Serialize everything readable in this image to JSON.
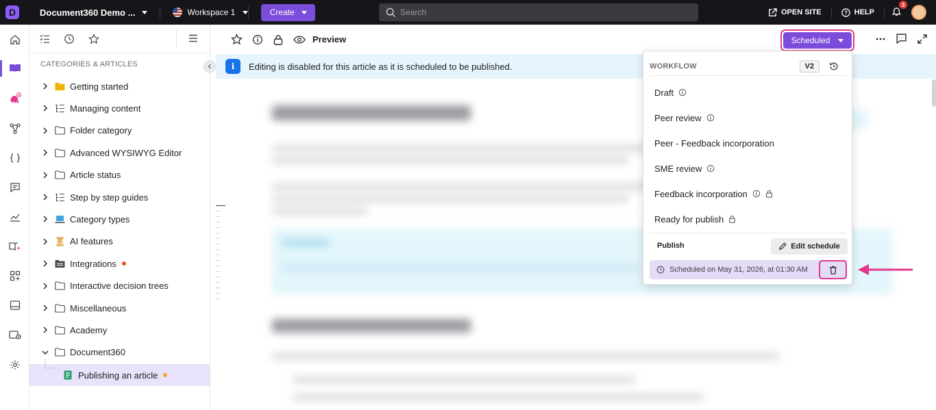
{
  "topbar": {
    "project_name": "Document360 Demo ...",
    "workspace": "Workspace 1",
    "create_label": "Create",
    "search_placeholder": "Search",
    "open_site": "OPEN SITE",
    "help": "HELP",
    "notification_count": "3"
  },
  "rail": {
    "items": [
      "home-icon",
      "documentation-icon",
      "ai-agent-icon",
      "api-icon",
      "code-icon",
      "feedback-icon",
      "analytics-icon",
      "knowledge-base-icon",
      "apps-icon",
      "widget-icon",
      "portal-settings-icon",
      "settings-icon"
    ],
    "ai_badge": "AI"
  },
  "categories": {
    "heading": "CATEGORIES & ARTICLES",
    "items": [
      {
        "label": "Getting started",
        "icon": "folder-yellow-icon"
      },
      {
        "label": "Managing content",
        "icon": "list-tree-icon"
      },
      {
        "label": "Folder category",
        "icon": "folder-outline-icon"
      },
      {
        "label": "Advanced WYSIWYG Editor",
        "icon": "folder-outline-icon"
      },
      {
        "label": "Article status",
        "icon": "folder-outline-icon"
      },
      {
        "label": "Step by step guides",
        "icon": "list-tree-icon"
      },
      {
        "label": "Category types",
        "icon": "laptop-icon"
      },
      {
        "label": "AI features",
        "icon": "scroll-icon"
      },
      {
        "label": "Integrations",
        "icon": "folder-dark-icon",
        "dot": "#f4511e"
      },
      {
        "label": "Interactive decision trees",
        "icon": "folder-outline-icon"
      },
      {
        "label": "Miscellaneous",
        "icon": "folder-outline-icon"
      },
      {
        "label": "Academy",
        "icon": "folder-outline-icon"
      },
      {
        "label": "Document360",
        "icon": "folder-outline-icon"
      }
    ],
    "selected_article": "Publishing an article",
    "selected_dot": "#f5a623"
  },
  "article_bar": {
    "preview": "Preview",
    "status": "Scheduled"
  },
  "notice": {
    "text": "Editing is disabled for this article as it is scheduled to be published."
  },
  "workflow": {
    "title": "WORKFLOW",
    "version": "V2",
    "statuses": [
      {
        "label": "Draft",
        "info": true,
        "lock": false
      },
      {
        "label": "Peer review",
        "info": true,
        "lock": false
      },
      {
        "label": "Peer - Feedback incorporation",
        "info": false,
        "lock": false
      },
      {
        "label": "SME review",
        "info": true,
        "lock": false
      },
      {
        "label": "Feedback incorporation",
        "info": true,
        "lock": true
      },
      {
        "label": "Ready for publish",
        "info": false,
        "lock": true
      }
    ],
    "publish_label": "Publish",
    "edit_schedule": "Edit schedule",
    "scheduled_text": "Scheduled on May 31, 2026, at 01:30 AM"
  },
  "colors": {
    "accent": "#7c4ddb",
    "highlight": "#e2388e",
    "topbar": "#16161a",
    "notice_bg": "#e6f4fd"
  }
}
